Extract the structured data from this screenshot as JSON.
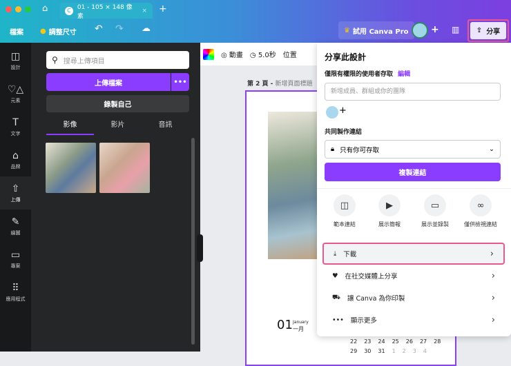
{
  "tabbar": {
    "tab_title": "01 - 105 × 148 像素",
    "close": "×",
    "new_tab": "+"
  },
  "toolbar": {
    "file": "檔案",
    "resize": "調整尺寸",
    "try_pro": "試用 Canva Pro",
    "add": "+",
    "share": "分享"
  },
  "rail": [
    {
      "label": "設計",
      "icon": "layout-icon"
    },
    {
      "label": "元素",
      "icon": "shapes-icon"
    },
    {
      "label": "文字",
      "icon": "text-icon"
    },
    {
      "label": "品牌",
      "icon": "brand-icon"
    },
    {
      "label": "上傳",
      "icon": "upload-icon"
    },
    {
      "label": "繪圖",
      "icon": "draw-icon"
    },
    {
      "label": "專案",
      "icon": "folder-icon"
    },
    {
      "label": "應用程式",
      "icon": "apps-icon"
    }
  ],
  "panel": {
    "search_placeholder": "搜尋上傳項目",
    "upload": "上傳檔案",
    "more": "•••",
    "record": "錄製自己",
    "tabs": [
      "影像",
      "影片",
      "音訊"
    ]
  },
  "context": {
    "animate": "動畫",
    "duration": "5.0秒",
    "position": "位置"
  },
  "page": {
    "label_num": "第 2 頁 - ",
    "label_title": "新增頁面標題",
    "month_num": "01",
    "month_en": "January",
    "month_zh": "一月",
    "week1": [
      "22",
      "23",
      "24",
      "25",
      "26",
      "27",
      "28"
    ],
    "week2": [
      "29",
      "30",
      "31",
      "1",
      "2",
      "3",
      "4"
    ]
  },
  "share": {
    "title": "分享此設計",
    "access": "僅限有權限的使用者存取",
    "edit": "編輯",
    "invite_placeholder": "新增成員、群組或你的團隊",
    "add": "+",
    "collab_label": "共同製作連結",
    "collab_value": "只有你可存取",
    "copy": "複製連結",
    "quick": [
      "範本連結",
      "展示簡報",
      "展示並錄製",
      "僅供檢視連結"
    ],
    "rows": [
      "下載",
      "在社交媒體上分享",
      "讓 Canva 為你印製",
      "顯示更多"
    ]
  },
  "colors": {
    "accent": "#8b3dff",
    "highlight": "#e8578f"
  }
}
